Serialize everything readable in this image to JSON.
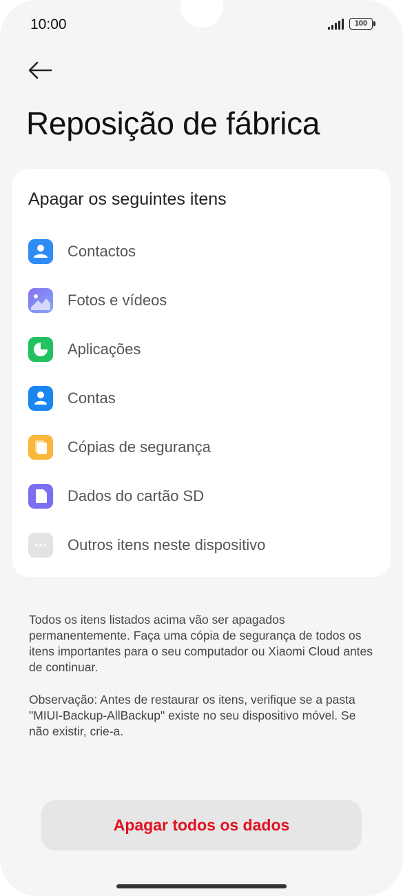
{
  "status": {
    "time": "10:00",
    "battery": "100"
  },
  "header": {
    "title": "Reposição de fábrica"
  },
  "card": {
    "title": "Apagar os seguintes itens",
    "items": [
      {
        "label": "Contactos",
        "icon": "contacts-icon",
        "color": "#2f8cf5"
      },
      {
        "label": "Fotos e vídeos",
        "icon": "gallery-icon",
        "color": "#7a74f0"
      },
      {
        "label": "Aplicações",
        "icon": "apps-icon",
        "color": "#20c15f"
      },
      {
        "label": "Contas",
        "icon": "account-icon",
        "color": "#1a87f0"
      },
      {
        "label": "Cópias de segurança",
        "icon": "backup-icon",
        "color": "#f9b73b"
      },
      {
        "label": "Dados do cartão SD",
        "icon": "sd-card-icon",
        "color": "#7c6ef0"
      },
      {
        "label": "Outros itens neste dispositivo",
        "icon": "more-icon",
        "color": "#e3e3e3"
      }
    ]
  },
  "notes": {
    "warning": "Todos os itens listados acima vão ser apagados permanentemente. Faça uma cópia de segurança de todos os itens importantes para o seu computador ou Xiaomi Cloud antes de continuar.",
    "observation": "Observação: Antes de restaurar os itens, verifique se a pasta \"MIUI-Backup-AllBackup\" existe no seu dispositivo móvel. Se não existir, crie-a."
  },
  "action": {
    "label": "Apagar todos os dados",
    "color": "#e0111f"
  }
}
